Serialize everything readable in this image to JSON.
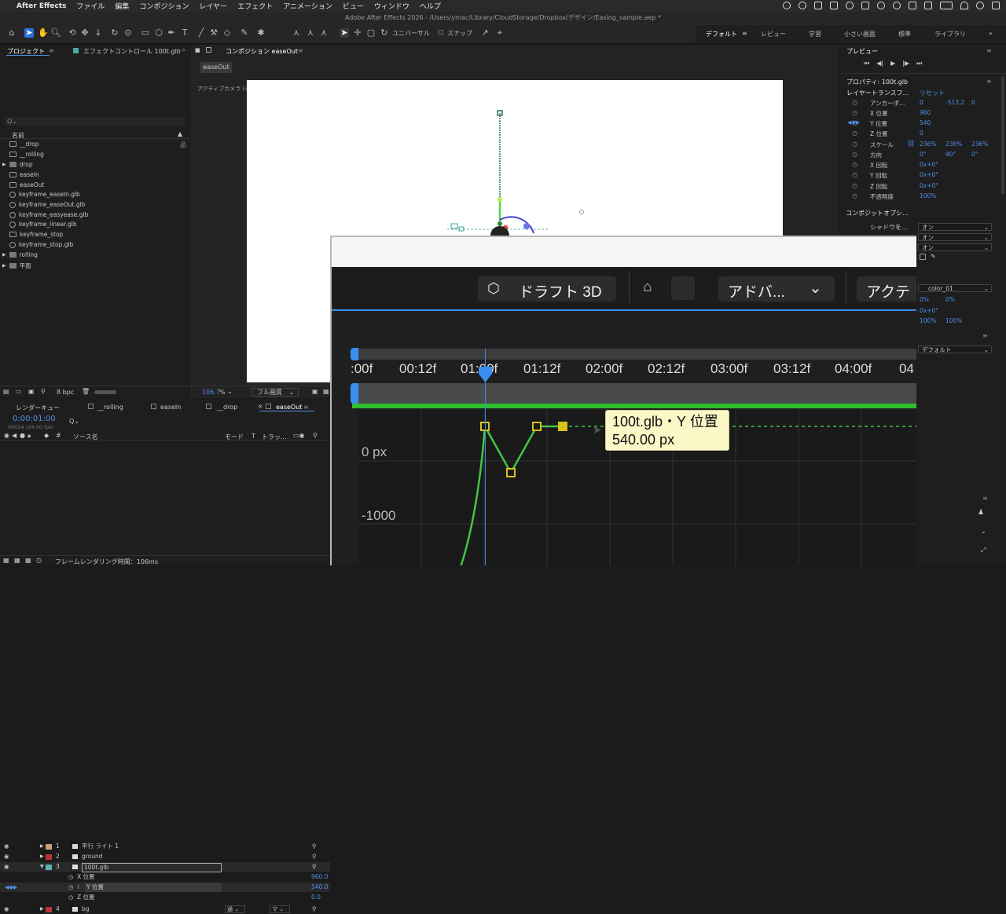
{
  "menubar": {
    "items": [
      "After Effects",
      "ファイル",
      "編集",
      "コンポジション",
      "レイヤー",
      "エフェクト",
      "アニメーション",
      "ビュー",
      "ウィンドウ",
      "ヘルプ"
    ]
  },
  "window_title": "Adobe After Effects 2026 - /Users/ymac/Library/CloudStorage/Dropbox/デザイン/Easing_sample.aep *",
  "toolbar": {
    "universal_label": "ユニバーサル",
    "snap_label": "スナップ",
    "workspaces": [
      "デフォルト",
      "レビュー",
      "学習",
      "小さい画面",
      "標準",
      "ライブラリ"
    ]
  },
  "project_panel": {
    "tab_project": "プロジェクト",
    "tab_effect": "エフェクトコントロール 100t.glb",
    "search_placeholder": "Q⌄",
    "col_name": "名前",
    "items": [
      "__drop",
      "__rolling",
      "drop",
      "easeIn",
      "easeOut",
      "keyframe_easeIn.glb",
      "keyframe_easeOut.glb",
      "keyframe_easyease.glb",
      "keyframe_linear.glb",
      "keyframe_stop",
      "keyframe_stop.glb",
      "rolling",
      "平面"
    ],
    "bpc": "8 bpc"
  },
  "comp_panel": {
    "tab": "コンポジション easeOut",
    "chip": "easeOut",
    "camera_label": "アクティブカメラ (デフォルト)",
    "zoom": "106.7",
    "zoom_unit": "%",
    "quality": "フル画質"
  },
  "preview_panel": {
    "title": "プレビュー"
  },
  "properties_panel": {
    "title": "プロパティ: 100t.glb",
    "section_transform": "レイヤートランスフ...",
    "reset": "リセット",
    "rows": [
      {
        "label": "アンカーポ...",
        "v1": "0",
        "v2": "-513.2",
        "v3": "0"
      },
      {
        "label": "X 位置",
        "v1": "960",
        "v2": "",
        "v3": ""
      },
      {
        "label": "Y 位置",
        "v1": "540",
        "v2": "",
        "v3": ""
      },
      {
        "label": "Z 位置",
        "v1": "0",
        "v2": "",
        "v3": ""
      },
      {
        "label": "スケール",
        "v1": "236%",
        "v2": "236%",
        "v3": "236%"
      },
      {
        "label": "方向",
        "v1": "0°",
        "v2": "90°",
        "v3": "0°"
      },
      {
        "label": "X 回転",
        "v1": "0x+0°",
        "v2": "",
        "v3": ""
      },
      {
        "label": "Y 回転",
        "v1": "0x+0°",
        "v2": "",
        "v3": ""
      },
      {
        "label": "Z 回転",
        "v1": "0x+0°",
        "v2": "",
        "v3": ""
      },
      {
        "label": "不透明度",
        "v1": "100%",
        "v2": "",
        "v3": ""
      }
    ],
    "section_composite": "コンポジットオプシ...",
    "shadow_label": "シャドウを...",
    "dd_values": [
      "オン",
      "オン",
      "オン"
    ],
    "material": "color_01",
    "mat_v1": "0%",
    "mat_v2": "0%",
    "mat_rot": "0x+0°",
    "mat_p1": "100%",
    "mat_p2": "100%",
    "default_dd": "デフォルト"
  },
  "timeline": {
    "tabs": [
      "レンダーキュー",
      "__rolling",
      "easeIn",
      "__drop",
      "easeOut"
    ],
    "timecode": "0:00:01:00",
    "frames": "00024 (24.00 fps)",
    "col_source": "ソース名",
    "col_mode": "モード",
    "col_t": "T",
    "col_track": "トラッ...",
    "layers": [
      {
        "num": "1",
        "name": "平行 ライト 1",
        "color": "#c9a27a"
      },
      {
        "num": "2",
        "name": "ground",
        "color": "#b8343a"
      },
      {
        "num": "3",
        "name": "100t.glb",
        "color": "#5fb3b3"
      },
      {
        "num": "4",
        "name": "bg",
        "color": "#b8343a"
      }
    ],
    "sub_props": [
      {
        "name": "X 位置",
        "value": "960.0"
      },
      {
        "name": "Y 位置",
        "value": "540.0"
      },
      {
        "name": "Z 位置",
        "value": "0.0"
      }
    ],
    "mode_value": "通",
    "track_value": "マ",
    "render_time": "フレームレンダリング時間：106ms"
  },
  "zoom_overlay": {
    "draft3d": "ドラフト 3D",
    "advanced": "アドバ...",
    "active": "アクテ",
    "ruler_labels": [
      ":00f",
      "00:12f",
      "01:00f",
      "01:12f",
      "02:00f",
      "02:12f",
      "03:00f",
      "03:12f",
      "04:00f",
      "04"
    ],
    "y_labels": [
      "0 px",
      "-1000"
    ],
    "tooltip_line1": "100t.glb・Y 位置",
    "tooltip_line2": "540.00 px"
  },
  "colors": {
    "accent": "#2c6fd6",
    "curve": "#45c443",
    "keyframe": "#d9c21a",
    "tooltip_bg": "#fbf7c6",
    "playhead": "#3a8ef0"
  }
}
